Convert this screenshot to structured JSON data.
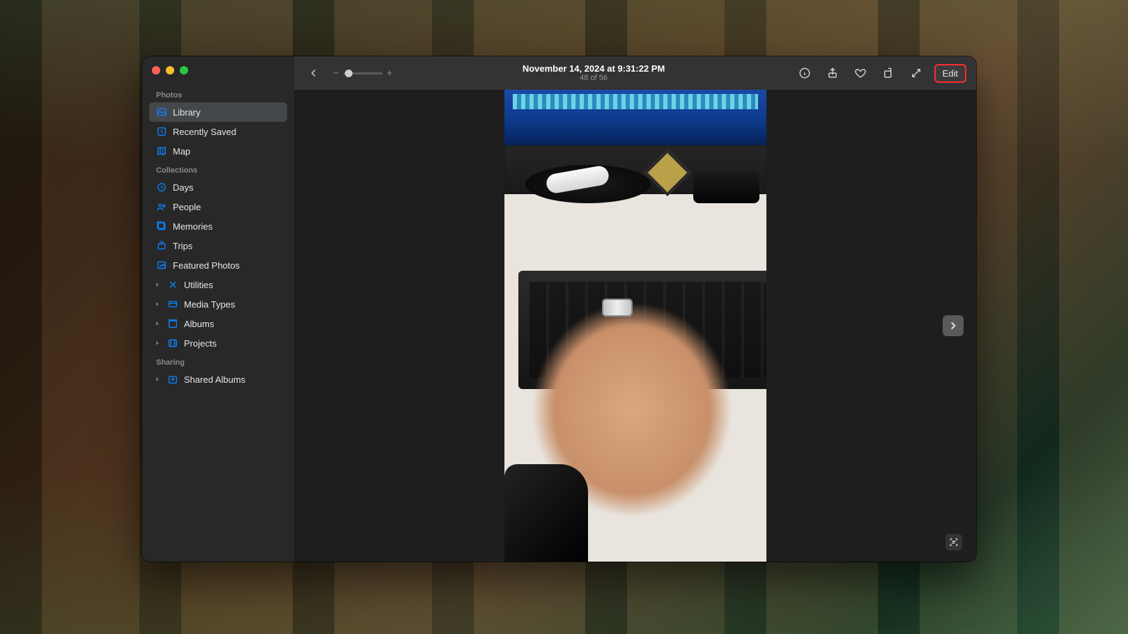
{
  "toolbar": {
    "title": "November 14, 2024 at 9:31:22 PM",
    "counter": "48 of 56",
    "edit_label": "Edit",
    "zoom_minus": "−",
    "zoom_plus": "+"
  },
  "sidebar": {
    "sections": {
      "photos_header": "Photos",
      "collections_header": "Collections",
      "sharing_header": "Sharing"
    },
    "photos": [
      {
        "label": "Library",
        "icon": "library-icon",
        "selected": true
      },
      {
        "label": "Recently Saved",
        "icon": "recently-saved-icon",
        "selected": false
      },
      {
        "label": "Map",
        "icon": "map-icon",
        "selected": false
      }
    ],
    "collections": [
      {
        "label": "Days",
        "icon": "days-icon",
        "disclosure": false
      },
      {
        "label": "People",
        "icon": "people-icon",
        "disclosure": false
      },
      {
        "label": "Memories",
        "icon": "memories-icon",
        "disclosure": false
      },
      {
        "label": "Trips",
        "icon": "trips-icon",
        "disclosure": false
      },
      {
        "label": "Featured Photos",
        "icon": "featured-icon",
        "disclosure": false
      },
      {
        "label": "Utilities",
        "icon": "utilities-icon",
        "disclosure": true
      },
      {
        "label": "Media Types",
        "icon": "media-types-icon",
        "disclosure": true
      },
      {
        "label": "Albums",
        "icon": "albums-icon",
        "disclosure": true
      },
      {
        "label": "Projects",
        "icon": "projects-icon",
        "disclosure": true
      }
    ],
    "sharing": [
      {
        "label": "Shared Albums",
        "icon": "shared-albums-icon",
        "disclosure": true
      }
    ]
  },
  "highlight_color": "#ff2b2b"
}
